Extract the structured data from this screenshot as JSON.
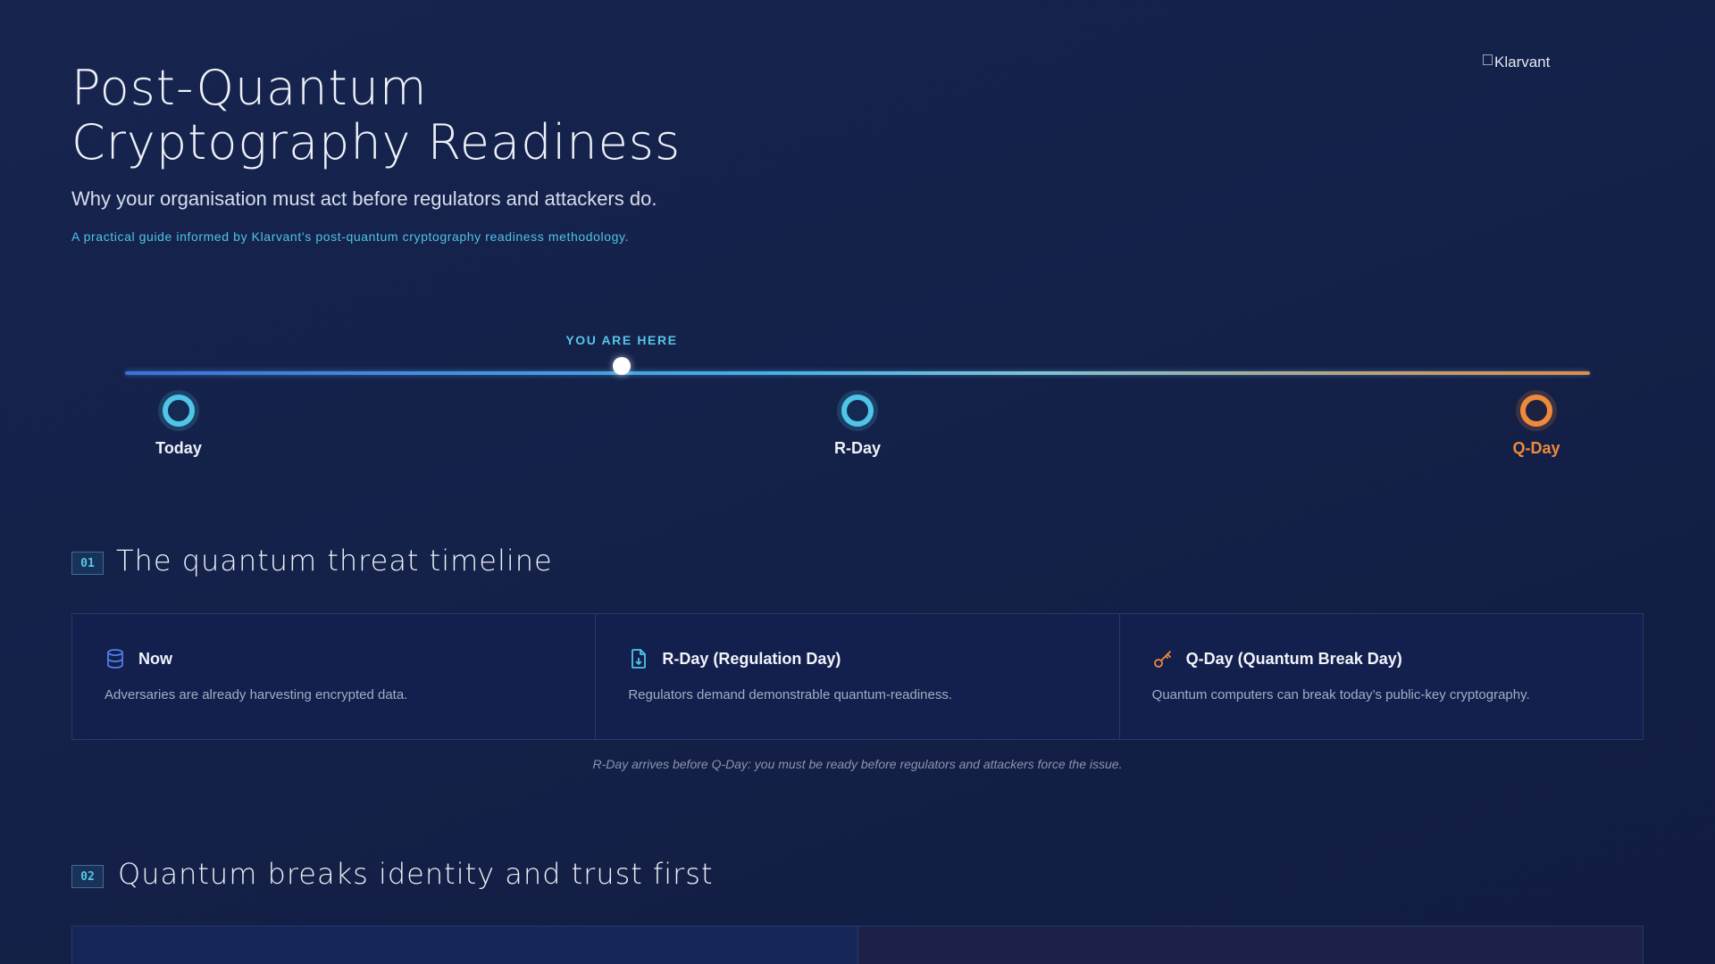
{
  "hero": {
    "title_line1": "Post-Quantum",
    "title_line2": "Cryptography Readiness",
    "subtitle": "Why your organisation must act before regulators and attackers do.",
    "guide": "A practical guide informed by Klarvant’s post-quantum cryptography readiness methodology."
  },
  "logo": {
    "alt": "Klarvant"
  },
  "timeline": {
    "here_label": "YOU ARE HERE",
    "markers": [
      {
        "label": "Today",
        "color": "#4fc6e8"
      },
      {
        "label": "R-Day",
        "color": "#4fc6e8"
      },
      {
        "label": "Q-Day",
        "color": "#ef8a3d"
      }
    ]
  },
  "sections": [
    {
      "number": "01",
      "title": "The quantum threat timeline"
    },
    {
      "number": "02",
      "title": "Quantum breaks identity and trust first"
    }
  ],
  "cards": [
    {
      "icon": "database-icon",
      "title": "Now",
      "description": "Adversaries are already harvesting encrypted data."
    },
    {
      "icon": "document-download-icon",
      "title": "R-Day (Regulation Day)",
      "description": "Regulators demand demonstrable quantum-readiness."
    },
    {
      "icon": "key-icon",
      "title": "Q-Day (Quantum Break Day)",
      "description": "Quantum computers can break today’s public-key cryptography."
    }
  ],
  "caption": "R-Day arrives before Q-Day: you must be ready before regulators and attackers force the issue.",
  "colors": {
    "accent_cyan": "#4fc6e8",
    "accent_orange": "#ef8a3d",
    "background": "#142149"
  }
}
